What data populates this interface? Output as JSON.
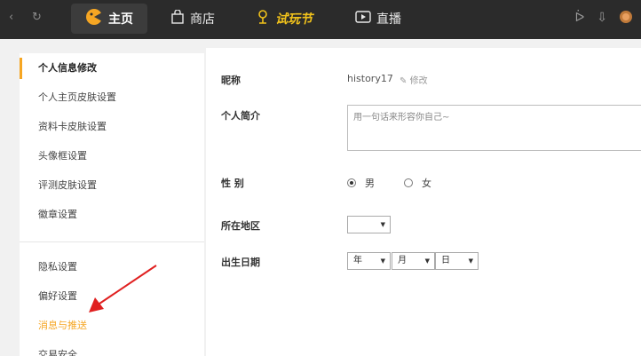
{
  "topbar": {
    "tabs": [
      {
        "label": "主页",
        "icon": "game-face-icon"
      },
      {
        "label": "商店",
        "icon": "bag-icon"
      },
      {
        "label": "试玩节",
        "icon": "trial-icon"
      },
      {
        "label": "直播",
        "icon": "play-icon"
      }
    ]
  },
  "sidebar": {
    "items": [
      {
        "label": "个人信息修改"
      },
      {
        "label": "个人主页皮肤设置"
      },
      {
        "label": "资料卡皮肤设置"
      },
      {
        "label": "头像框设置"
      },
      {
        "label": "评测皮肤设置"
      },
      {
        "label": "徽章设置"
      },
      {
        "label": "隐私设置"
      },
      {
        "label": "偏好设置"
      },
      {
        "label": "消息与推送"
      },
      {
        "label": "交易安全"
      }
    ]
  },
  "form": {
    "nickname_label": "昵称",
    "nickname_value": "history17",
    "edit_label": "修改",
    "intro_label": "个人简介",
    "intro_placeholder": "用一句话来形容你自己~",
    "gender_label": "性 别",
    "gender_male": "男",
    "gender_female": "女",
    "gender_selected": "男",
    "region_label": "所在地区",
    "region_value": "",
    "birth_label": "出生日期",
    "year": "年",
    "month": "月",
    "day": "日"
  },
  "colors": {
    "accent": "#f6a623",
    "topbar_bg": "#2b2b2b",
    "arrow": "#e02020"
  }
}
